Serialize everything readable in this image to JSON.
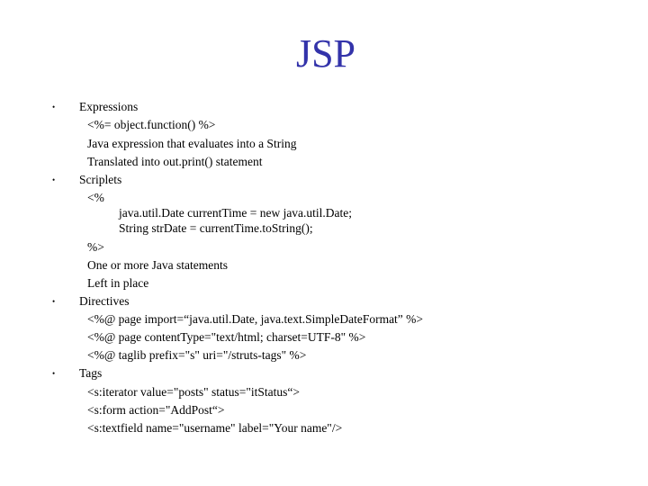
{
  "slide": {
    "title": "JSP",
    "title_color": "#3333aa",
    "bullet_glyph": "•",
    "sections": [
      {
        "heading": "Expressions",
        "lines": [
          "<%= object.function() %>",
          "Java expression that evaluates into a String",
          "Translated into out.print() statement"
        ]
      },
      {
        "heading": "Scriplets",
        "open_tag": "<%",
        "code_lines": [
          "java.util.Date currentTime = new java.util.Date;",
          "String strDate = currentTime.toString();"
        ],
        "close_tag": "%>",
        "lines": [
          "One or more Java statements",
          "Left in place"
        ]
      },
      {
        "heading": "Directives",
        "lines": [
          "<%@ page import=“java.util.Date, java.text.SimpleDateFormat” %>",
          "<%@ page contentType=\"text/html; charset=UTF-8\" %>",
          "<%@ taglib prefix=\"s\" uri=\"/struts-tags\" %>"
        ]
      },
      {
        "heading": "Tags",
        "lines": [
          "<s:iterator value=\"posts\" status=\"itStatus“>",
          "<s:form action=\"AddPost“>",
          "<s:textfield name=\"username\" label=\"Your name\"/>"
        ]
      }
    ]
  }
}
